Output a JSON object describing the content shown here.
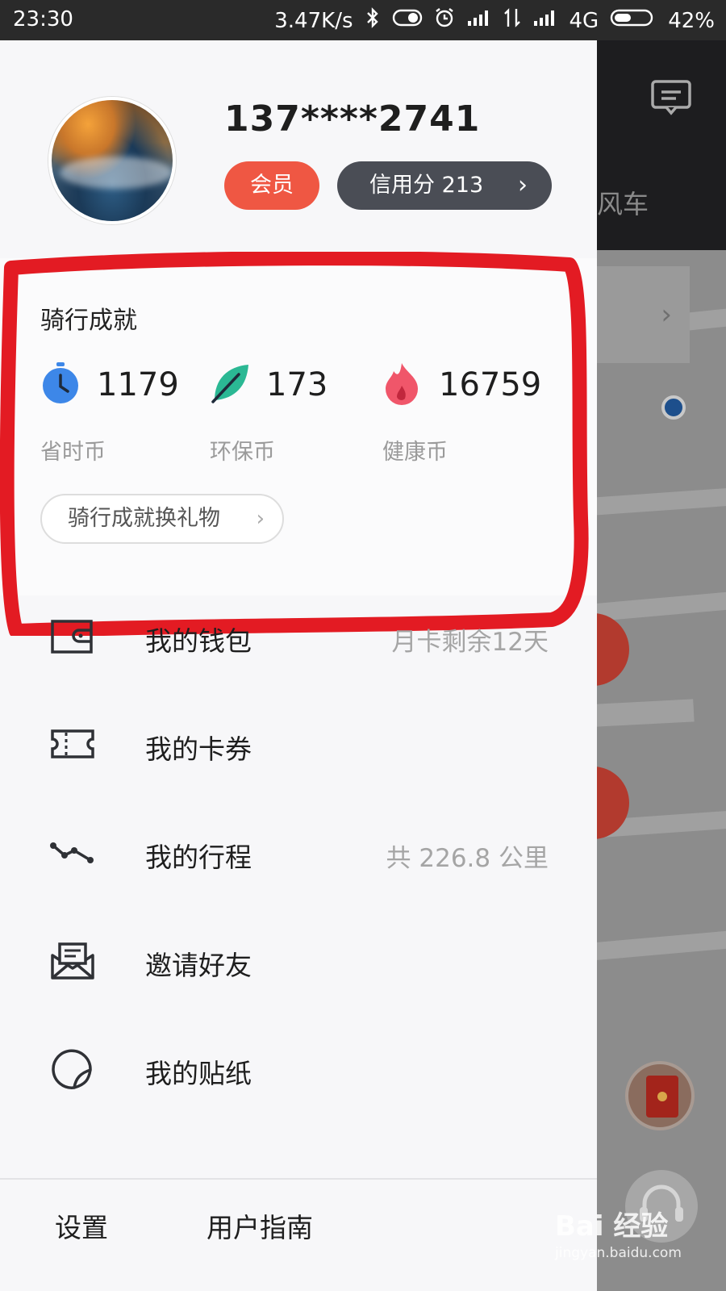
{
  "status_bar": {
    "time": "23:30",
    "network_speed": "3.47K/s",
    "network_type": "4G",
    "battery": "42%"
  },
  "background": {
    "tab_label": "风车",
    "icons": [
      "chat-icon",
      "location-dot",
      "red-packet-icon",
      "customer-service-icon"
    ]
  },
  "profile": {
    "phone": "137****2741",
    "member_label": "会员",
    "credit_label": "信用分 213"
  },
  "achievements": {
    "title": "骑行成就",
    "stats": [
      {
        "icon": "clock-icon",
        "value": "1179",
        "label": "省时币",
        "color": "#3d87e8"
      },
      {
        "icon": "leaf-icon",
        "value": "173",
        "label": "环保币",
        "color": "#2bb894"
      },
      {
        "icon": "flame-icon",
        "value": "16759",
        "label": "健康币",
        "color": "#f0566a"
      }
    ],
    "gift_button": "骑行成就换礼物",
    "highlight_color": "#e31b23"
  },
  "menu": [
    {
      "icon": "wallet-icon",
      "label": "我的钱包",
      "extra": "月卡剩余12天"
    },
    {
      "icon": "coupon-icon",
      "label": "我的卡券",
      "extra": ""
    },
    {
      "icon": "trip-icon",
      "label": "我的行程",
      "extra": "共 226.8 公里"
    },
    {
      "icon": "invite-icon",
      "label": "邀请好友",
      "extra": ""
    },
    {
      "icon": "sticker-icon",
      "label": "我的贴纸",
      "extra": ""
    }
  ],
  "footer": {
    "settings": "设置",
    "guide": "用户指南"
  },
  "watermark": {
    "brand": "Bai 经验",
    "url": "jingyan.baidu.com"
  }
}
